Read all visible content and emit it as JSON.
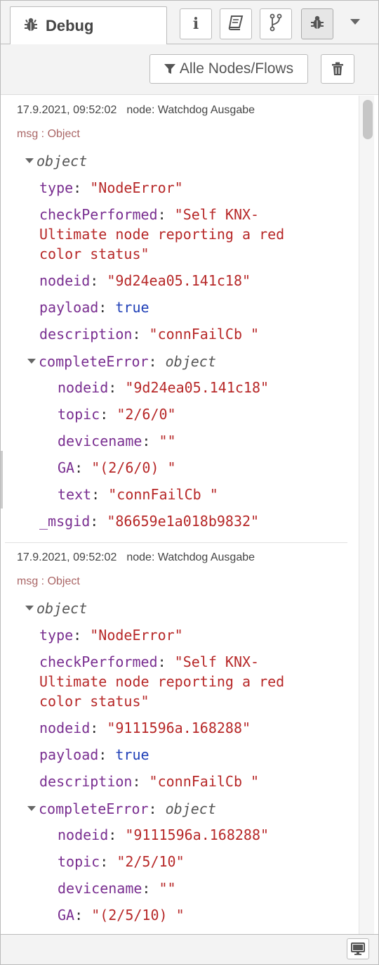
{
  "tabs": {
    "debug_label": "Debug",
    "buttons": [
      {
        "name": "info-tab-button",
        "icon": "info-icon",
        "glyph": "i"
      },
      {
        "name": "help-tab-button",
        "icon": "book-icon"
      },
      {
        "name": "context-tab-button",
        "icon": "branch-icon"
      },
      {
        "name": "debug-tab-button",
        "icon": "bug-icon",
        "selected": true
      }
    ]
  },
  "toolbar": {
    "filter_label": "Alle Nodes/Flows",
    "clear_icon": "trash-icon"
  },
  "messages": [
    {
      "timestamp": "17.9.2021, 09:52:02",
      "node": "node: Watchdog Ausgabe",
      "topic": "msg : Object",
      "root_label": "object",
      "type_key": "type",
      "type_val": "\"NodeError\"",
      "check_key": "checkPerformed",
      "check_l1": "\"Self KNX-",
      "check_l2": "Ultimate node reporting a red",
      "check_l3": "color status\"",
      "nodeid_key": "nodeid",
      "nodeid_val": "\"9d24ea05.141c18\"",
      "payload_key": "payload",
      "payload_val": "true",
      "desc_key": "description",
      "desc_val": "\"connFailCb \"",
      "ce_key": "completeError",
      "ce_val": "object",
      "ce_nodeid_val": "\"9d24ea05.141c18\"",
      "ce_topic_key": "topic",
      "ce_topic_val": "\"2/6/0\"",
      "ce_devicename_key": "devicename",
      "ce_devicename_val": "\"\"",
      "ce_ga_key": "GA",
      "ce_ga_val": "\"(2/6/0) \"",
      "ce_text_key": "text",
      "ce_text_val": "\"connFailCb \"",
      "msgid_key": "_msgid",
      "msgid_val": "\"86659e1a018b9832\""
    },
    {
      "timestamp": "17.9.2021, 09:52:02",
      "node": "node: Watchdog Ausgabe",
      "topic": "msg : Object",
      "root_label": "object",
      "type_key": "type",
      "type_val": "\"NodeError\"",
      "check_key": "checkPerformed",
      "check_l1": "\"Self KNX-",
      "check_l2": "Ultimate node reporting a red",
      "check_l3": "color status\"",
      "nodeid_key": "nodeid",
      "nodeid_val": "\"9111596a.168288\"",
      "payload_key": "payload",
      "payload_val": "true",
      "desc_key": "description",
      "desc_val": "\"connFailCb \"",
      "ce_key": "completeError",
      "ce_val": "object",
      "ce_nodeid_val": "\"9111596a.168288\"",
      "ce_topic_key": "topic",
      "ce_topic_val": "\"2/5/10\"",
      "ce_devicename_key": "devicename",
      "ce_devicename_val": "\"\"",
      "ce_ga_key": "GA",
      "ce_ga_val": "\"(2/5/10) \""
    }
  ],
  "footer": {
    "icon": "monitor-icon"
  }
}
